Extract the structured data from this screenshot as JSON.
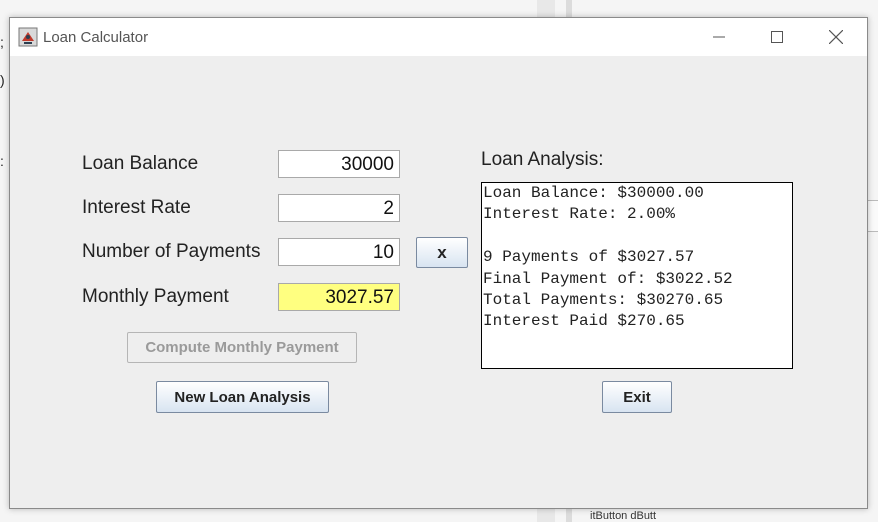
{
  "window": {
    "title": "Loan Calculator",
    "controls": {
      "minimize": "minimize-icon",
      "maximize": "maximize-icon",
      "close": "close-icon"
    }
  },
  "background": {
    "left_glyphs": [
      ";",
      ")",
      ":"
    ],
    "bottom_text": "itButton  dButt"
  },
  "form": {
    "loan_balance": {
      "label": "Loan Balance",
      "value": "30000"
    },
    "interest_rate": {
      "label": "Interest Rate",
      "value": "2"
    },
    "num_payments": {
      "label": "Number of Payments",
      "value": "10"
    },
    "monthly_payment": {
      "label": "Monthly Payment",
      "value": "3027.57"
    },
    "clear_label": "x"
  },
  "buttons": {
    "compute": "Compute Monthly Payment",
    "new_analysis": "New Loan Analysis",
    "exit": "Exit"
  },
  "analysis": {
    "title": "Loan Analysis:",
    "lines": [
      "Loan Balance: $30000.00",
      "Interest Rate: 2.00%",
      "",
      "9 Payments of $3027.57",
      "Final Payment of: $3022.52",
      "Total Payments: $30270.65",
      "Interest Paid $270.65"
    ]
  },
  "colors": {
    "result_field": "#ffff80",
    "window_bg": "#eeeeee"
  }
}
